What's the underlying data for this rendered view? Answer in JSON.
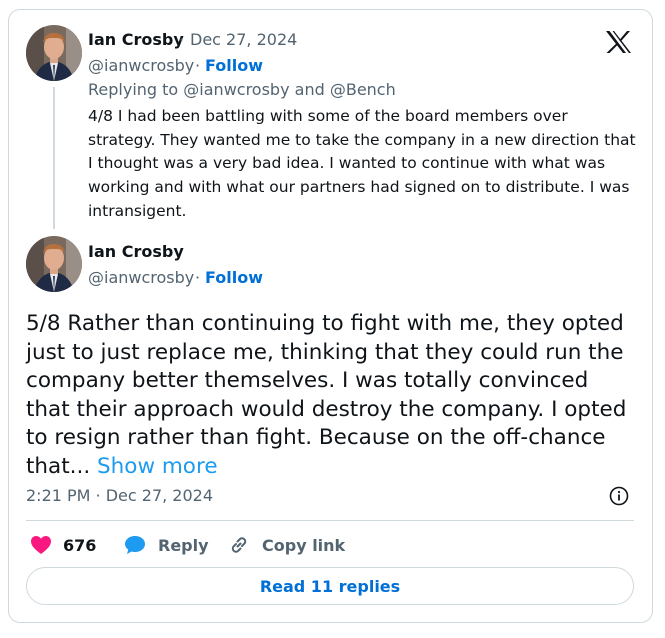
{
  "brand": {
    "logo_icon": "x-logo-icon"
  },
  "colors": {
    "link": "#1d9bf0",
    "like": "#f91880",
    "reply": "#1d9bf0",
    "muted": "#536471",
    "border": "#cfd9de"
  },
  "parent_tweet": {
    "author_name": "Ian Crosby",
    "separator": "·",
    "date": "Dec 27, 2024",
    "handle": "@ianwcrosby",
    "follow_label": "Follow",
    "replying_prefix": "Replying to",
    "replying_user1": "@ianwcrosby",
    "replying_and": "and",
    "replying_user2": "@Bench",
    "text": "4/8 I had been battling with some of the board members over strategy. They wanted me to take the company in a new direction that I thought was a very bad idea. I wanted to continue with what was working and with what our partners had signed on to distribute. I was intransigent."
  },
  "main_tweet": {
    "author_name": "Ian Crosby",
    "separator": "·",
    "handle": "@ianwcrosby",
    "follow_label": "Follow",
    "text": "5/8 Rather than continuing to fight with me, they opted just to just replace me, thinking that they could run the company better themselves. I was totally convinced that their approach would destroy the company. I opted to resign rather than fight. Because on the off-chance that...",
    "show_more_label": "Show more",
    "timestamp": "2:21 PM · Dec 27, 2024",
    "info_icon": "info-icon"
  },
  "actions": {
    "like_count": "676",
    "like_icon": "heart-icon",
    "reply_label": "Reply",
    "reply_icon": "reply-bubble-icon",
    "copy_label": "Copy link",
    "copy_icon": "link-icon"
  },
  "read_replies_label": "Read 11 replies"
}
